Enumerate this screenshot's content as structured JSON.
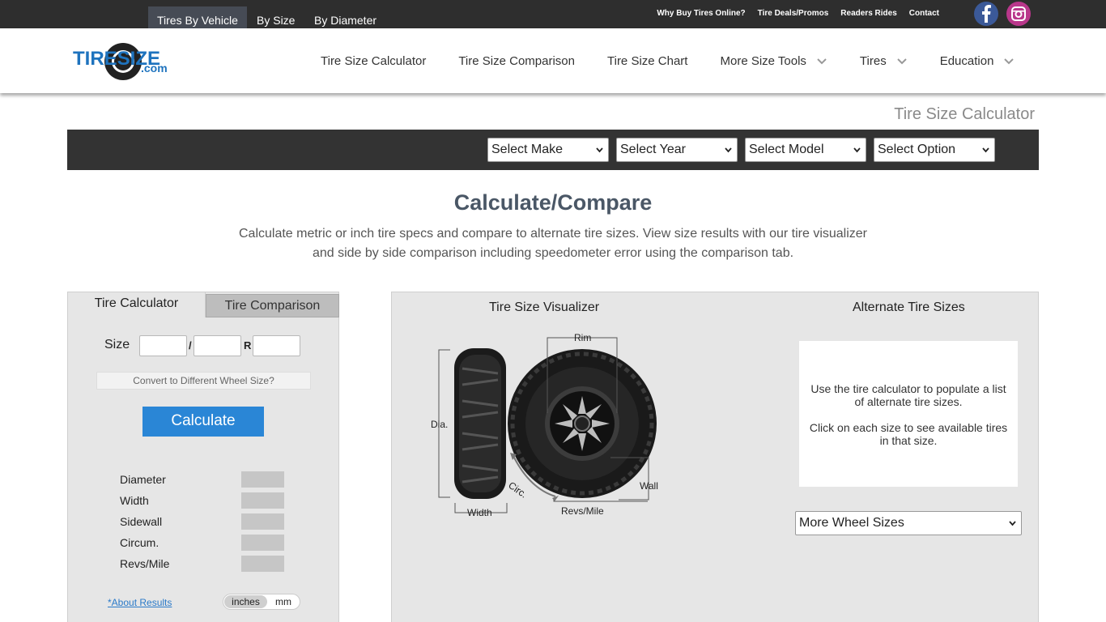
{
  "topbar": {
    "links": [
      "Why Buy Tires Online?",
      "Tire Deals/Promos",
      "Readers Rides",
      "Contact"
    ]
  },
  "header": {
    "logo_text": "TIRESIZE",
    "logo_sub": ".com",
    "nav": [
      {
        "label": "Tire Size Calculator"
      },
      {
        "label": "Tire Size Comparison"
      },
      {
        "label": "Tire Size Chart"
      },
      {
        "label": "More Size Tools"
      },
      {
        "label": "Tires"
      },
      {
        "label": "Education"
      }
    ]
  },
  "page_heading": "Tire Size Calculator",
  "vehicle_bar": {
    "tabs": [
      "Tires By Vehicle",
      "By Size",
      "By Diameter"
    ],
    "selects": [
      "Select Make",
      "Select Year",
      "Select Model",
      "Select Option"
    ]
  },
  "main": {
    "title": "Calculate/Compare",
    "intro_line1": "Calculate metric or inch tire specs and compare to alternate tire sizes. View size results with our tire visualizer",
    "intro_line2": "and side by side comparison including speedometer error using the comparison tab."
  },
  "calculator": {
    "tabs": [
      "Tire Calculator",
      "Tire Comparison"
    ],
    "size_label": "Size",
    "slash": "/",
    "r_label": "R",
    "inputs": [
      "",
      "",
      ""
    ],
    "convert_label": "Convert to Different Wheel Size?",
    "calculate_label": "Calculate",
    "results": [
      {
        "label": "Diameter",
        "value": ""
      },
      {
        "label": "Width",
        "value": ""
      },
      {
        "label": "Sidewall",
        "value": ""
      },
      {
        "label": "Circum.",
        "value": ""
      },
      {
        "label": "Revs/Mile",
        "value": ""
      }
    ],
    "about_link": "*About Results",
    "units": [
      "inches",
      "mm"
    ]
  },
  "visualizer": {
    "title": "Tire Size Visualizer",
    "labels": {
      "rim": "Rim",
      "dia": "Dia.",
      "circ": "Circ.",
      "wall": "Wall",
      "width": "Width",
      "revs": "Revs/Mile"
    }
  },
  "alternate": {
    "title": "Alternate Tire Sizes",
    "text1": "Use the tire calculator to populate a list of alternate tire sizes.",
    "text2": "Click on each size to see available tires in that size.",
    "select_label": "More Wheel Sizes"
  }
}
